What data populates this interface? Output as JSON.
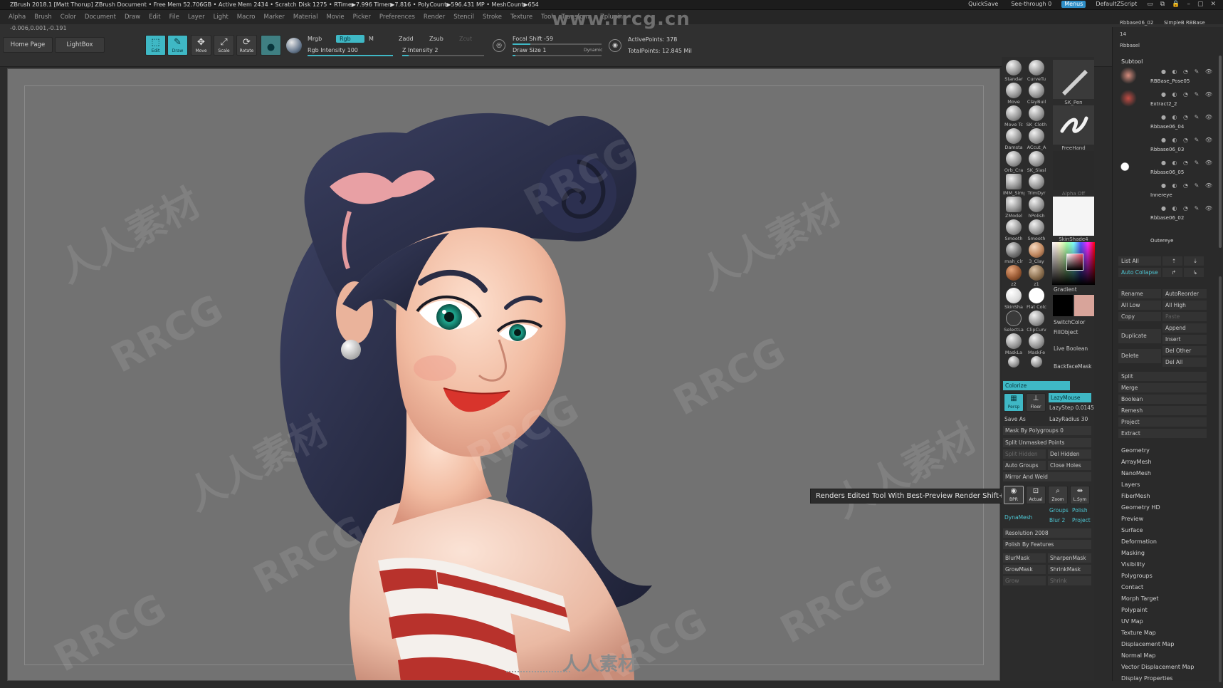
{
  "titlebar": {
    "text": "ZBrush 2018.1 [Matt Thorup]   ZBrush Document     • Free Mem 52.706GB • Active Mem 2434 • Scratch Disk 1275 • RTime▶7.996 Timer▶7.816 • PolyCount▶596.431 MP • MeshCount▶654",
    "quicksave": "QuickSave",
    "see_through": "See-through  0",
    "menus": "Menus",
    "default_zscript": "DefaultZScript"
  },
  "menubar": [
    "Alpha",
    "Brush",
    "Color",
    "Document",
    "Draw",
    "Edit",
    "File",
    "Layer",
    "Light",
    "Macro",
    "Marker",
    "Material",
    "Movie",
    "Picker",
    "Preferences",
    "Render",
    "Stencil",
    "Stroke",
    "Texture",
    "Tool",
    "Transform",
    "Zplugin"
  ],
  "toolbar": {
    "coords": "-0.006,0.001,-0.191",
    "home_page": "Home Page",
    "lightbox": "LightBox",
    "tools": [
      {
        "label": "Edit",
        "icon": "edit-icon",
        "active": true
      },
      {
        "label": "Draw",
        "icon": "draw-icon",
        "active": true
      },
      {
        "label": "Move",
        "icon": "move-icon",
        "active": false
      },
      {
        "label": "Scale",
        "icon": "scale-icon",
        "active": false
      },
      {
        "label": "Rotate",
        "icon": "rotate-icon",
        "active": false
      }
    ],
    "mrgb": "Mrgb",
    "rgb": "Rgb",
    "m": "M",
    "rgb_intensity": "Rgb Intensity 100",
    "zadd": "Zadd",
    "zsub": "Zsub",
    "zcut": "Zcut",
    "z_intensity": "Z Intensity 2",
    "focal_shift": "Focal Shift -59",
    "draw_size": "Draw Size 1",
    "dynamic": "Dynamic",
    "active_points": "ActivePoints: 378",
    "total_points": "TotalPoints: 12.845 Mil"
  },
  "watermarks": {
    "top": "www.rrcg.cn",
    "bottom": "人人素材",
    "rrcg": "RRCG",
    "cn": "人人素材"
  },
  "viewport": {
    "tooltip": "Renders Edited Tool With Best-Preview Render  Shift+R"
  },
  "brushes": [
    {
      "label": "Standar"
    },
    {
      "label": "CurveTu"
    },
    {
      "label": "Move"
    },
    {
      "label": "ClayBuil"
    },
    {
      "label": "Move Tc"
    },
    {
      "label": "SK_Cloth"
    },
    {
      "label": "Damsta"
    },
    {
      "label": "ACcut_A"
    },
    {
      "label": "Orb_Cra"
    },
    {
      "label": "SK_Slasl"
    },
    {
      "label": "IMM_Simp"
    },
    {
      "label": "TrimDyr"
    },
    {
      "label": "ZModel"
    },
    {
      "label": "hPolish"
    },
    {
      "label": "Smooth"
    },
    {
      "label": "Smooth"
    },
    {
      "label": "mah_clr"
    },
    {
      "label": "3_Clay"
    },
    {
      "label": "z2"
    },
    {
      "label": "z1"
    },
    {
      "label": "SkinSha"
    },
    {
      "label": "Flat Colc"
    },
    {
      "label": "SelectLa"
    },
    {
      "label": "ClipCurv"
    },
    {
      "label": "MaskLa"
    },
    {
      "label": "MaskFe"
    }
  ],
  "brush_tiles": {
    "sk_pen": "SK_Pen",
    "freehand": "FreeHand",
    "alpha_off": "Alpha Off",
    "skinshade": "SkinShade4",
    "gradient": "Gradient",
    "switchcolor": "SwitchColor",
    "fillobject": "FillObject",
    "live_boolean": "Live Boolean",
    "backfacemask": "BackfaceMask",
    "colorize": "Colorize"
  },
  "brush_panel": {
    "persp": "Persp",
    "floor": "Floor",
    "lazymouse": "LazyMouse",
    "lazystep": "LazyStep 0.0145",
    "save_as": "Save As",
    "lazyradius": "LazyRadius 30",
    "mask_by_polygroups": "Mask By Polygroups 0",
    "split_unmasked": "Split Unmasked Points",
    "split_hidden": "Split Hidden",
    "del_hidden": "Del Hidden",
    "auto_groups": "Auto Groups",
    "close_holes": "Close Holes",
    "mirror_and_weld": "Mirror And Weld",
    "bpr": "BPR",
    "actual": "Actual",
    "zoom": "Zoom",
    "l_sym": "L.Sym",
    "groups": "Groups",
    "polish": "Polish",
    "dynamesh": "DynaMesh",
    "blur": "Blur 2",
    "project": "Project",
    "resolution": "Resolution 2008",
    "polish_by_features": "Polish By Features",
    "blurmask": "BlurMask",
    "sharpenmask": "SharpenMask",
    "growmask": "GrowMask",
    "shrinkmask": "ShrinkMask",
    "grow": "Grow",
    "shrink": "Shrink"
  },
  "subtool": {
    "top_names": [
      "Rbbase06_02",
      "SimpleB RBBase"
    ],
    "count": "14",
    "rbbasel": "Rbbasel",
    "header": "Subtool",
    "items": [
      {
        "name": "RBBase_Pose05"
      },
      {
        "name": "Extract2_2"
      },
      {
        "name": "Rbbase06_04"
      },
      {
        "name": "Rbbase06_03"
      },
      {
        "name": "Rbbase06_05"
      },
      {
        "name": "Innereye"
      },
      {
        "name": "Rbbase06_02"
      },
      {
        "name": "Outereye"
      }
    ],
    "list_all": "List All",
    "auto_collapse": "Auto Collapse",
    "rename": "Rename",
    "autoreorder": "AutoReorder",
    "all_low": "All Low",
    "all_high": "All High",
    "copy": "Copy",
    "paste": "Paste",
    "append": "Append",
    "duplicate": "Duplicate",
    "insert": "Insert",
    "delete": "Delete",
    "del_other": "Del Other",
    "del_all": "Del All",
    "split": "Split",
    "merge": "Merge",
    "boolean": "Boolean",
    "remesh": "Remesh",
    "project": "Project",
    "extract": "Extract"
  },
  "tool_menu": [
    "Geometry",
    "ArrayMesh",
    "NanoMesh",
    "Layers",
    "FiberMesh",
    "Geometry HD",
    "Preview",
    "Surface",
    "Deformation",
    "Masking",
    "Visibility",
    "Polygroups",
    "Contact",
    "Morph Target",
    "Polypaint",
    "UV Map",
    "Texture Map",
    "Displacement Map",
    "Normal Map",
    "Vector Displacement Map",
    "Display Properties"
  ],
  "colors": {
    "accent": "#3fb8c5",
    "viewport_bg": "#727272",
    "hair": "#2a2d45",
    "skin": "#f2c0a6",
    "lips": "#d8342c",
    "stripe_red": "#b8322c",
    "ribbon": "#e8a0a4"
  }
}
